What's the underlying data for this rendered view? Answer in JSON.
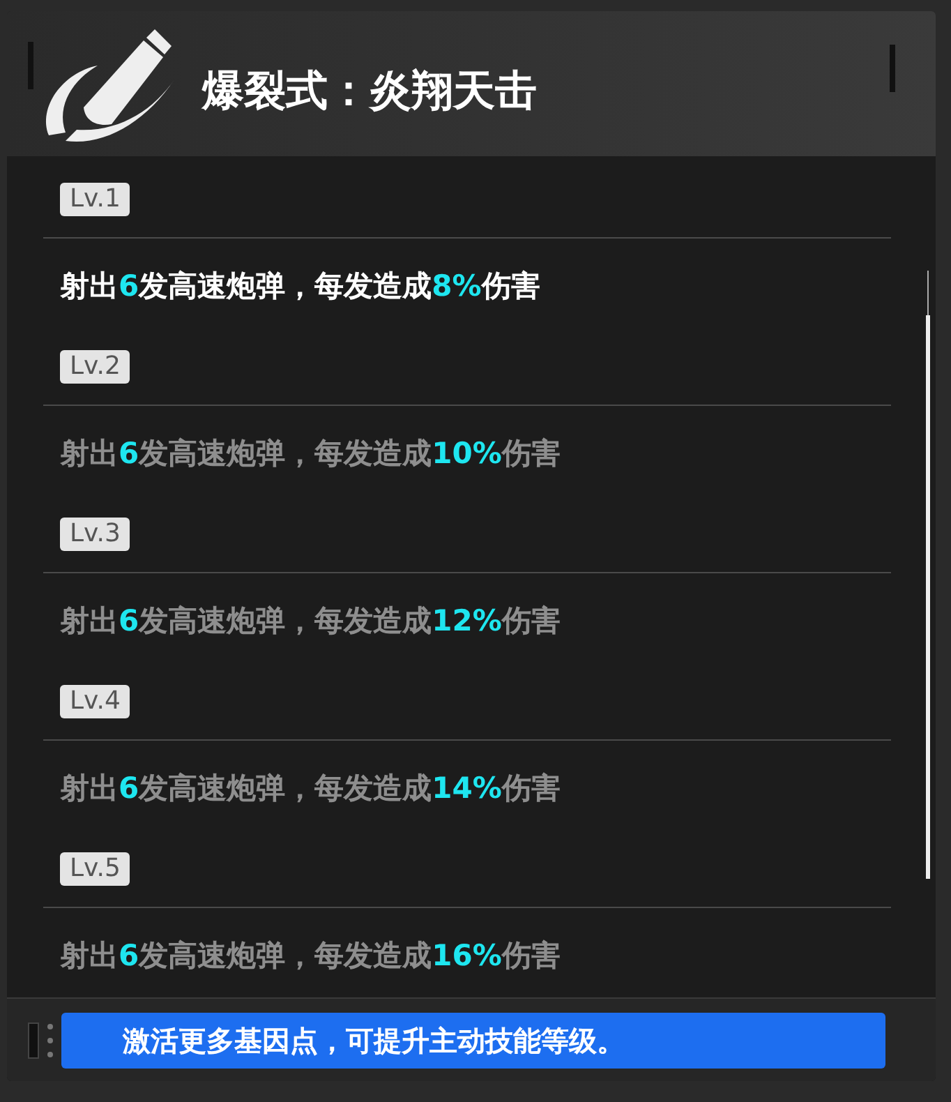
{
  "header": {
    "title": "爆裂式：炎翔天击"
  },
  "levels": [
    {
      "badge": "Lv.1",
      "current": true,
      "parts": [
        {
          "text": "射出",
          "highlight": false
        },
        {
          "text": "6",
          "highlight": true
        },
        {
          "text": "发高速炮弹，每发造成",
          "highlight": false
        },
        {
          "text": "8%",
          "highlight": true
        },
        {
          "text": "伤害",
          "highlight": false
        }
      ]
    },
    {
      "badge": "Lv.2",
      "current": false,
      "parts": [
        {
          "text": "射出",
          "highlight": false
        },
        {
          "text": "6",
          "highlight": true
        },
        {
          "text": "发高速炮弹，每发造成",
          "highlight": false
        },
        {
          "text": "10%",
          "highlight": true
        },
        {
          "text": "伤害",
          "highlight": false
        }
      ]
    },
    {
      "badge": "Lv.3",
      "current": false,
      "parts": [
        {
          "text": "射出",
          "highlight": false
        },
        {
          "text": "6",
          "highlight": true
        },
        {
          "text": "发高速炮弹，每发造成",
          "highlight": false
        },
        {
          "text": "12%",
          "highlight": true
        },
        {
          "text": "伤害",
          "highlight": false
        }
      ]
    },
    {
      "badge": "Lv.4",
      "current": false,
      "parts": [
        {
          "text": "射出",
          "highlight": false
        },
        {
          "text": "6",
          "highlight": true
        },
        {
          "text": "发高速炮弹，每发造成",
          "highlight": false
        },
        {
          "text": "14%",
          "highlight": true
        },
        {
          "text": "伤害",
          "highlight": false
        }
      ]
    },
    {
      "badge": "Lv.5",
      "current": false,
      "parts": [
        {
          "text": "射出",
          "highlight": false
        },
        {
          "text": "6",
          "highlight": true
        },
        {
          "text": "发高速炮弹，每发造成",
          "highlight": false
        },
        {
          "text": "16%",
          "highlight": true
        },
        {
          "text": "伤害",
          "highlight": false
        }
      ]
    }
  ],
  "footer": {
    "hint": "激活更多基因点，可提升主动技能等级。"
  }
}
